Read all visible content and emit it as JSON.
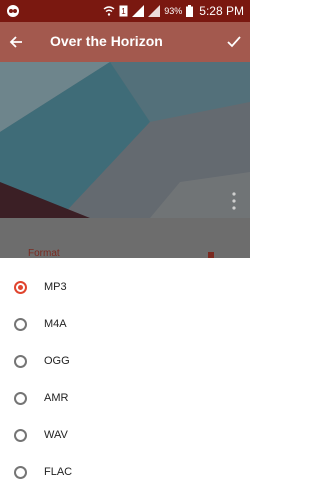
{
  "status_bar": {
    "battery": "93%",
    "time": "5:28 PM"
  },
  "toolbar": {
    "title": "Over the Horizon",
    "back_icon": "back-arrow-icon",
    "confirm_icon": "check-icon"
  },
  "background": {
    "format_label": "Format"
  },
  "format_options": [
    {
      "label": "MP3",
      "selected": true
    },
    {
      "label": "M4A",
      "selected": false
    },
    {
      "label": "OGG",
      "selected": false
    },
    {
      "label": "AMR",
      "selected": false
    },
    {
      "label": "WAV",
      "selected": false
    },
    {
      "label": "FLAC",
      "selected": false
    }
  ],
  "colors": {
    "accent": "#e0452f",
    "toolbar": "#852213",
    "status_bar": "#7a1810"
  }
}
